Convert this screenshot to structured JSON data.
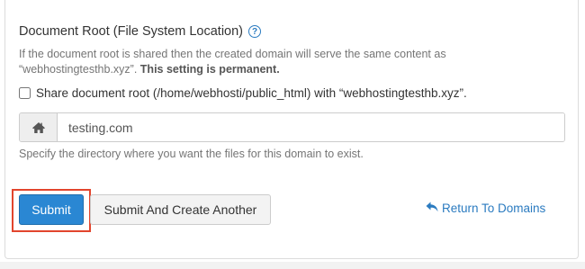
{
  "section": {
    "title": "Document Root (File System Location)",
    "help_icon": "question-circle-icon",
    "description_part1": "If the document root is shared then the created domain will serve the same content as “webhostingtesthb.xyz”. ",
    "description_bold": "This setting is permanent."
  },
  "share_root": {
    "label": "Share document root (/home/webhosti/public_html) with “webhostingtesthb.xyz”.",
    "checked": false
  },
  "document_root_input": {
    "icon": "home-icon",
    "value": "testing.com"
  },
  "help_text": "Specify the directory where you want the files for this domain to exist.",
  "actions": {
    "submit_label": "Submit",
    "submit_create_label": "Submit And Create Another",
    "return_label": "Return To Domains",
    "return_icon": "reply-arrow-icon"
  },
  "colors": {
    "primary": "#2a87d3",
    "link": "#2b7bc0",
    "highlight": "#e2452d"
  }
}
